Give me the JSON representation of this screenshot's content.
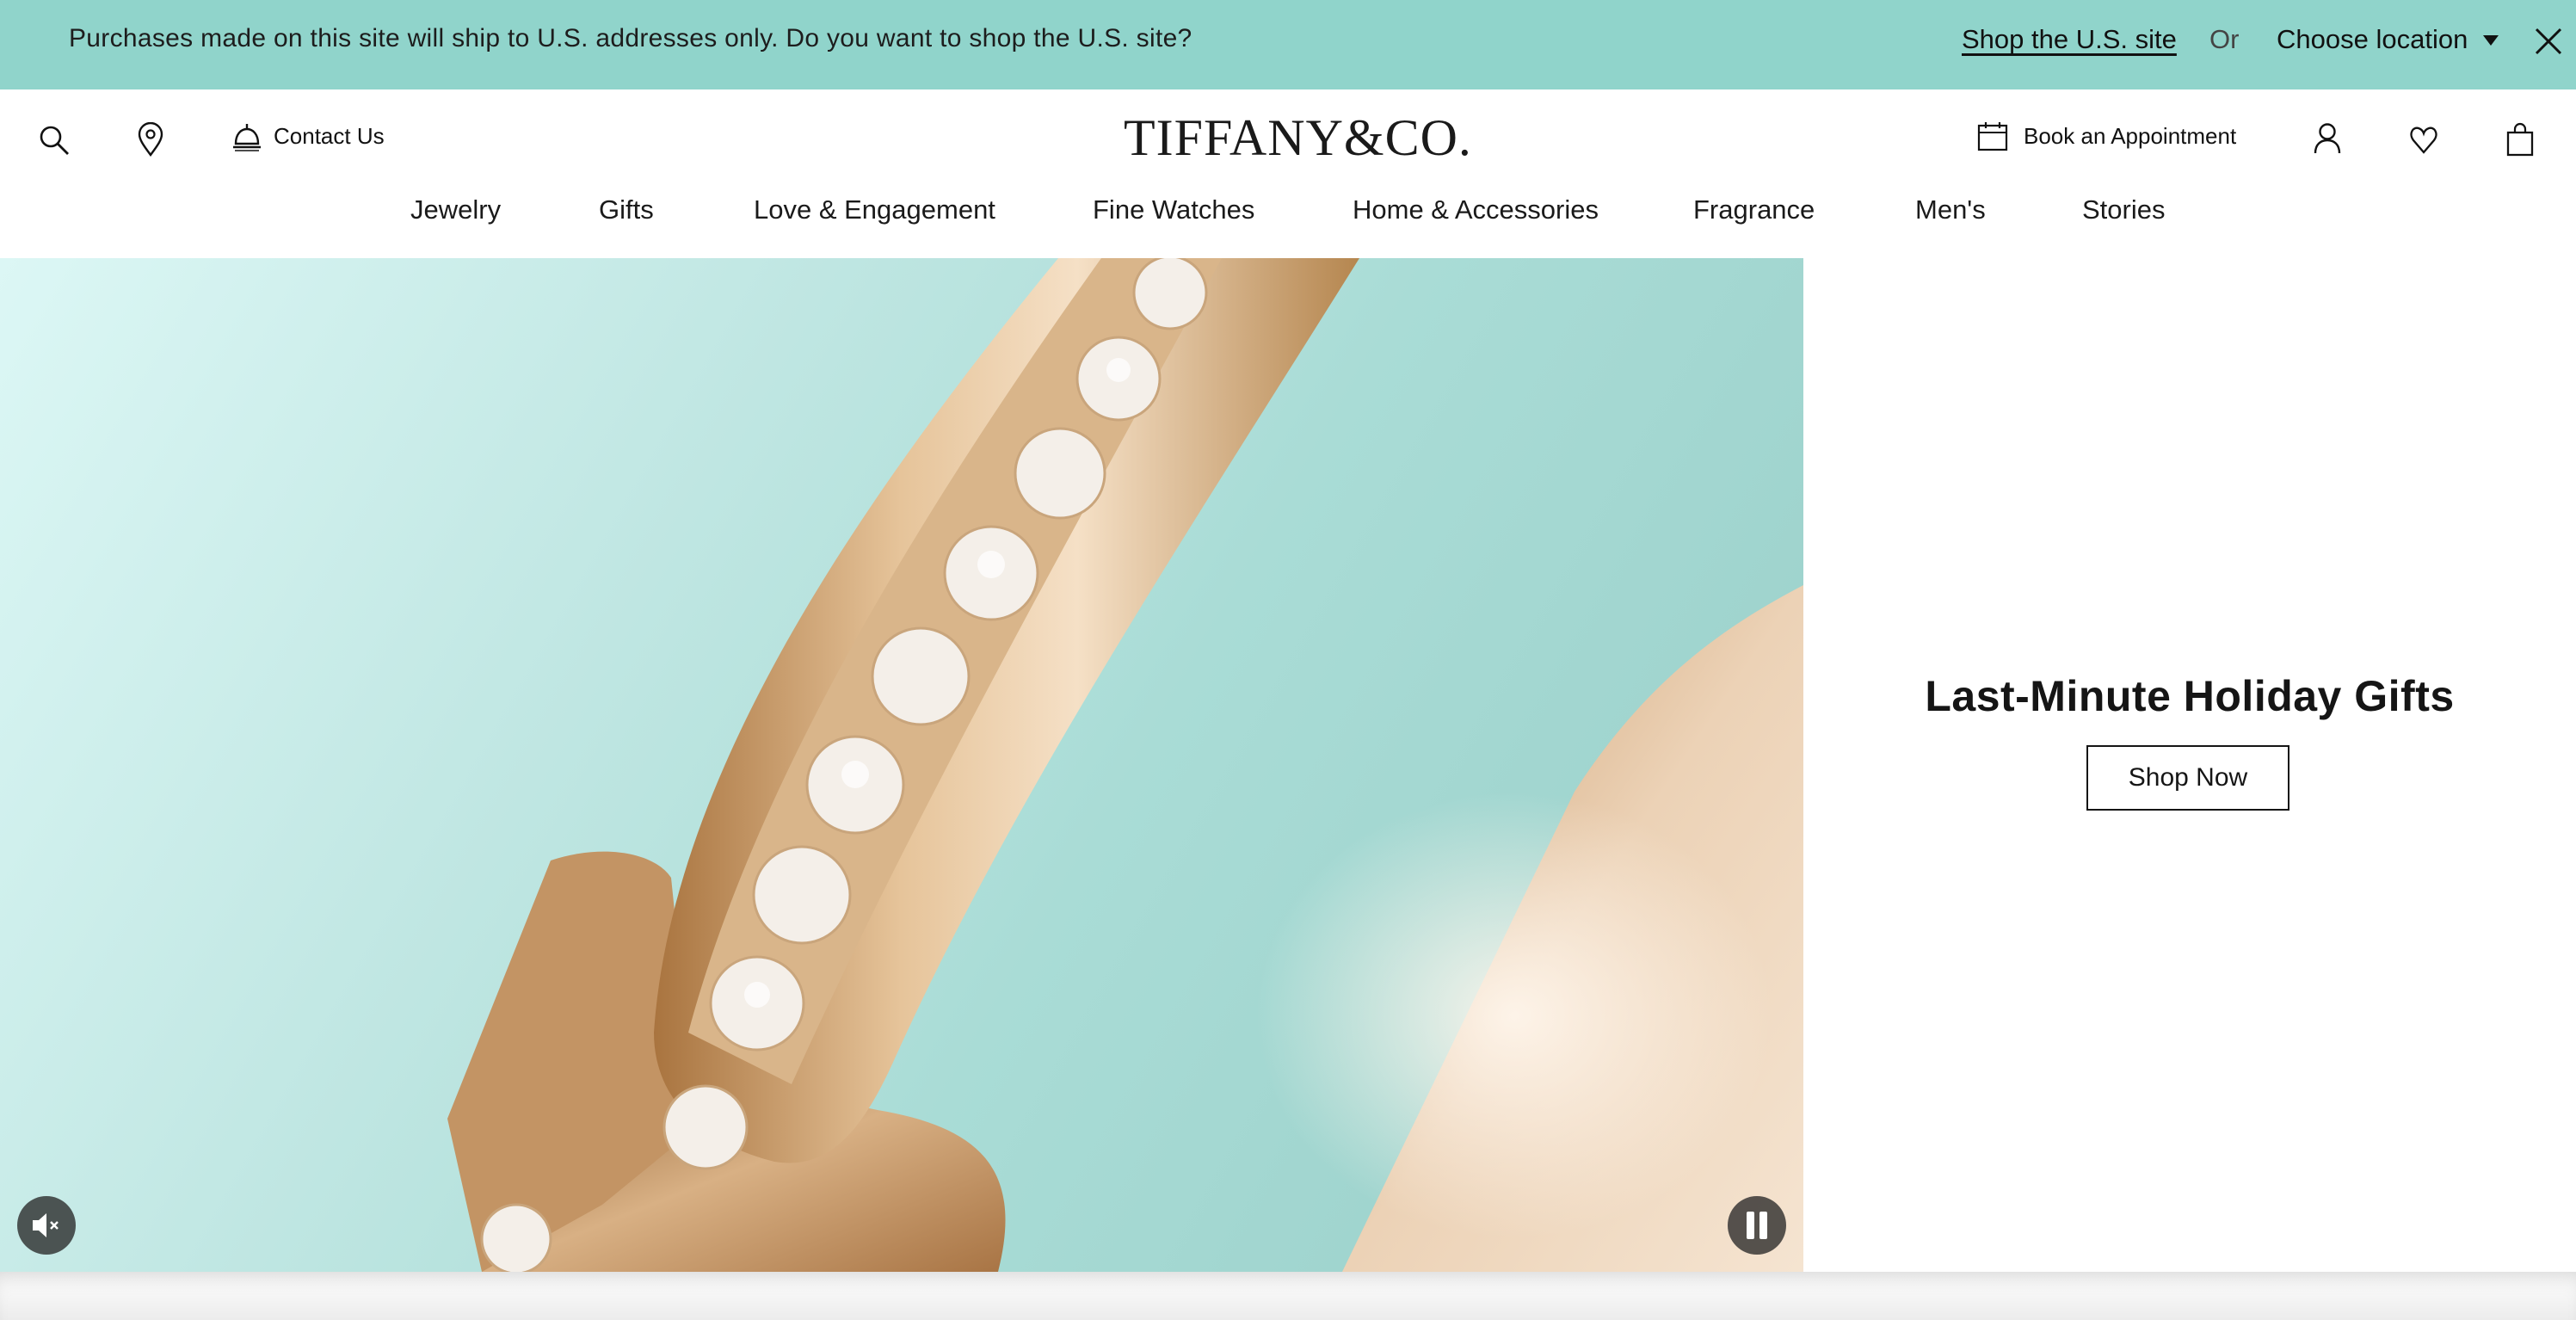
{
  "banner": {
    "message": "Purchases made on this site will ship to U.S. addresses only. Do you want to shop the U.S. site?",
    "shop_link": "Shop the U.S. site",
    "or_text": "Or",
    "choose_location": "Choose location",
    "background": "#90d4cb"
  },
  "header": {
    "contact_label": "Contact Us",
    "logo_text": "TIFFANY&CO.",
    "appointment_label": "Book an Appointment"
  },
  "nav": {
    "items": [
      "Jewelry",
      "Gifts",
      "Love & Engagement",
      "Fine Watches",
      "Home & Accessories",
      "Fragrance",
      "Men's",
      "Stories"
    ]
  },
  "promo": {
    "title": "Last-Minute Holiday Gifts",
    "button_label": "Shop Now"
  },
  "icons": {
    "search": "search-icon",
    "location": "location-pin-icon",
    "contact": "service-bell-icon",
    "appointment": "calendar-icon",
    "account": "person-icon",
    "wishlist": "heart-icon",
    "bag": "shopping-bag-icon",
    "mute": "muted-speaker-icon",
    "pause": "pause-icon",
    "close": "close-icon"
  }
}
